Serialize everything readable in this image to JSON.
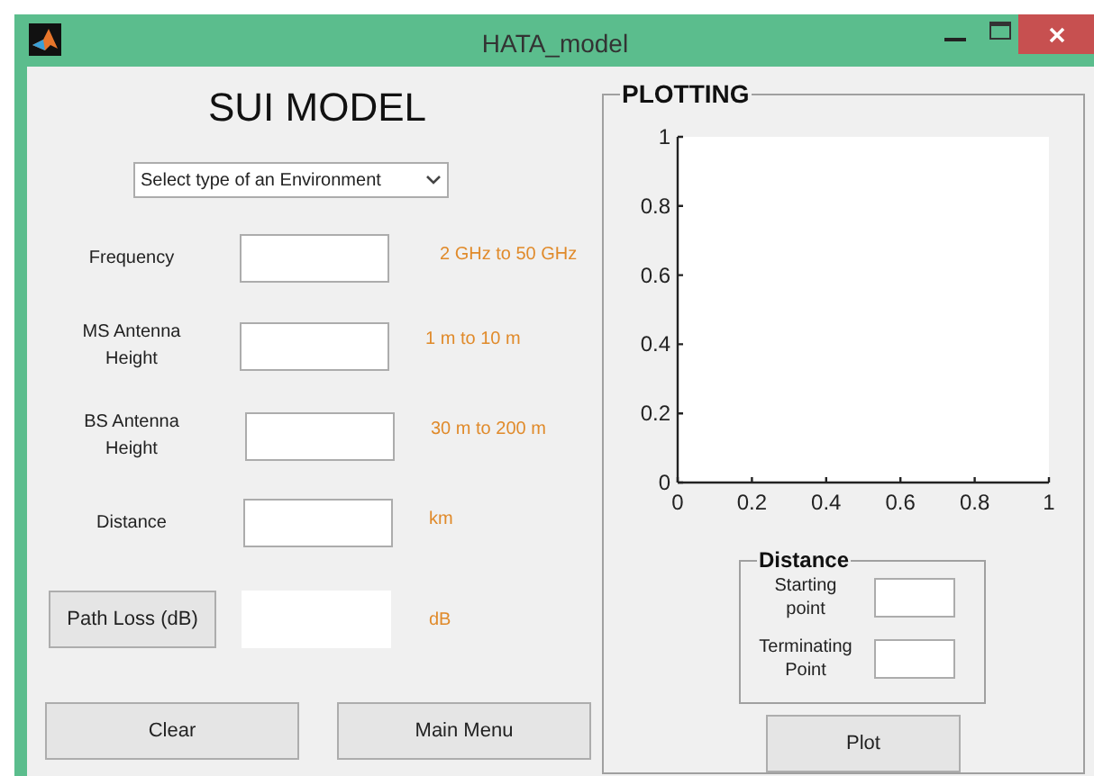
{
  "window": {
    "title": "HATA_model"
  },
  "heading": "SUI MODEL",
  "environment_dropdown": {
    "value": "Select type of an Environment"
  },
  "fields": [
    {
      "label": "Frequency",
      "hint": "2 GHz to 50 GHz"
    },
    {
      "label": "MS Antenna Height",
      "hint": "1 m to 10 m"
    },
    {
      "label": "BS Antenna Height",
      "hint": "30 m to 200 m"
    },
    {
      "label": "Distance",
      "hint": "km"
    }
  ],
  "path_loss": {
    "button": "Path Loss (dB)",
    "unit": "dB"
  },
  "buttons": [
    "Clear",
    "Main Menu"
  ],
  "plotting": {
    "title": "PLOTTING",
    "chart_data": {
      "type": "line",
      "xlim": [
        0,
        1
      ],
      "ylim": [
        0,
        1
      ],
      "xticks": [
        {
          "value": 0,
          "label": "0"
        },
        {
          "value": 0.2,
          "label": "0.2"
        },
        {
          "value": 0.4,
          "label": "0.4"
        },
        {
          "value": 0.6,
          "label": "0.6"
        },
        {
          "value": 0.8,
          "label": "0.8"
        },
        {
          "value": 1,
          "label": "1"
        }
      ],
      "yticks": [
        {
          "value": 0,
          "label": "0"
        },
        {
          "value": 0.2,
          "label": "0.2"
        },
        {
          "value": 0.4,
          "label": "0.4"
        },
        {
          "value": 0.6,
          "label": "0.6"
        },
        {
          "value": 0.8,
          "label": "0.8"
        },
        {
          "value": 1,
          "label": "1"
        }
      ]
    },
    "distance": {
      "title": "Distance",
      "fields": [
        {
          "label": "Starting point"
        },
        {
          "label": "Terminating Point"
        }
      ]
    },
    "button": "Plot"
  }
}
